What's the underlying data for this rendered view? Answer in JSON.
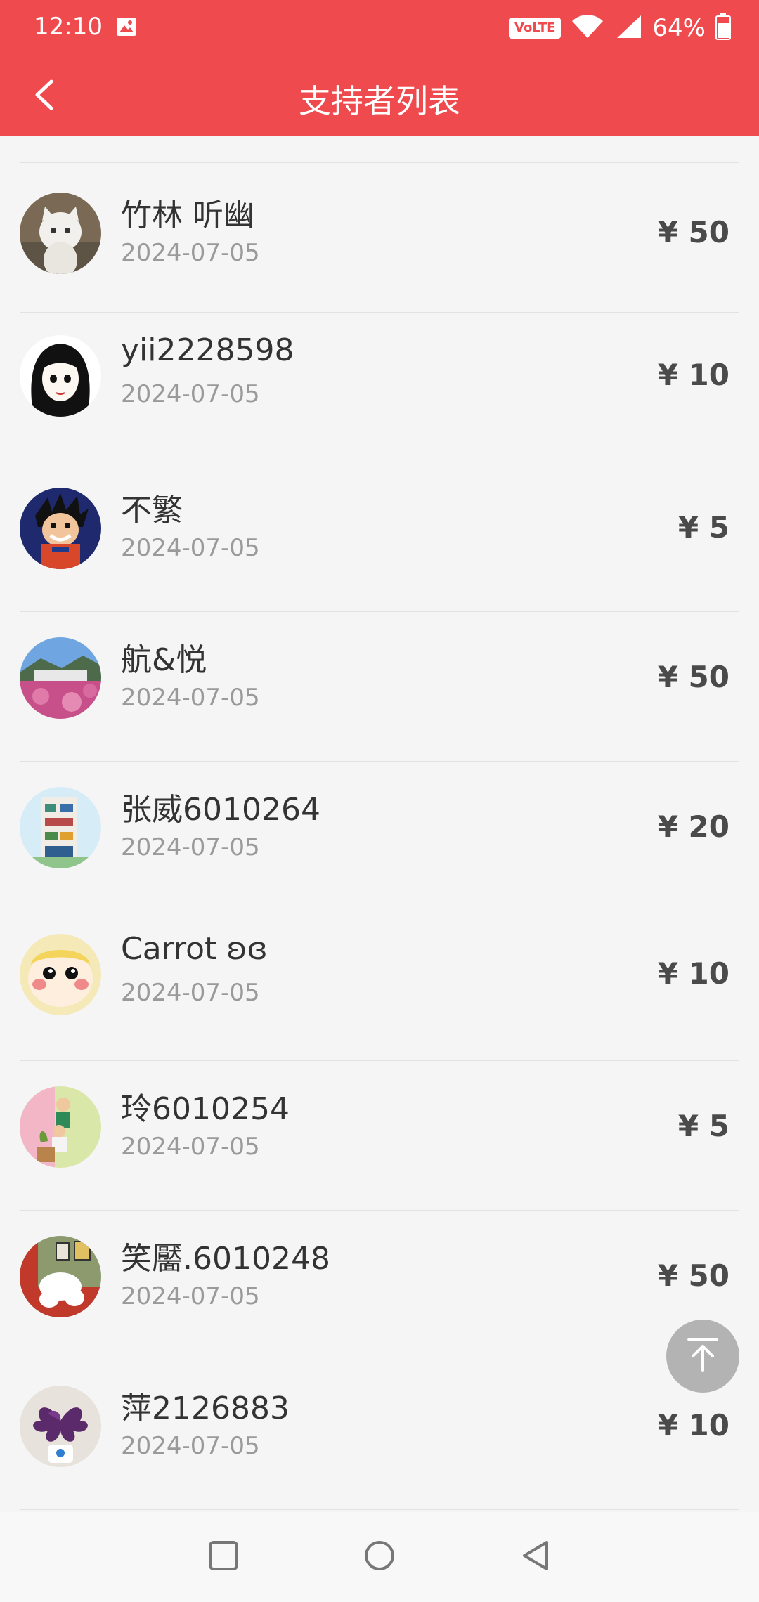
{
  "status_bar": {
    "time": "12:10",
    "volte": "VoLTE",
    "battery": "64%"
  },
  "header": {
    "title": "支持者列表"
  },
  "supporters": [
    {
      "name": "竹林 听幽",
      "date": "2024-07-05",
      "amount": "¥ 50"
    },
    {
      "name": "yii2228598",
      "date": "2024-07-05",
      "amount": "¥ 10"
    },
    {
      "name": "不繁",
      "date": "2024-07-05",
      "amount": "¥ 5"
    },
    {
      "name": "航&悦",
      "date": "2024-07-05",
      "amount": "¥ 50"
    },
    {
      "name": "张威6010264",
      "date": "2024-07-05",
      "amount": "¥ 20"
    },
    {
      "name": "Carrot ʚɞ",
      "date": "2024-07-05",
      "amount": "¥ 10"
    },
    {
      "name": "玲6010254",
      "date": "2024-07-05",
      "amount": "¥ 5"
    },
    {
      "name": "笑靨.6010248",
      "date": "2024-07-05",
      "amount": "¥ 50"
    },
    {
      "name": "萍2126883",
      "date": "2024-07-05",
      "amount": "¥ 10"
    }
  ],
  "icons": {
    "back": "chevron-left-icon",
    "back_to_top": "arrow-up-to-top-icon",
    "nav_recents": "square-icon",
    "nav_home": "circle-icon",
    "nav_back": "triangle-back-icon"
  },
  "colors": {
    "brand_red": "#ef4b4e",
    "background": "#f5f5f5"
  }
}
